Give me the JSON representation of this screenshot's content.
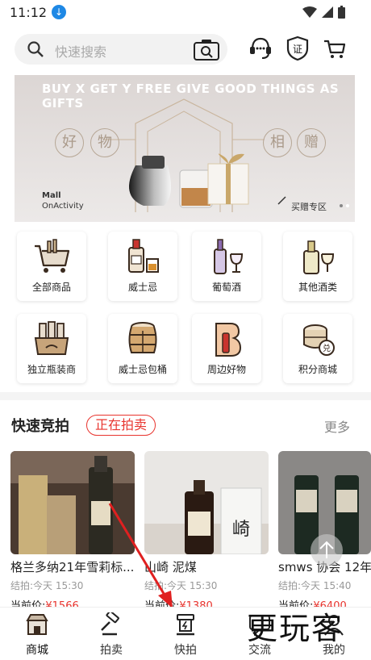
{
  "status_bar": {
    "time": "11:12"
  },
  "search": {
    "placeholder": "快速搜索"
  },
  "banner": {
    "headline": "BUY X GET Y FREE  GIVE GOOD THINGS AS GIFTS",
    "chars": [
      "好",
      "物",
      "相",
      "赠"
    ],
    "mall_line1": "Mall",
    "mall_line2": "OnActivity",
    "cta": "买赠专区"
  },
  "categories": [
    {
      "label": "全部商品",
      "icon": "shopping-cart-icon"
    },
    {
      "label": "威士忌",
      "icon": "whisky-bottle-icon"
    },
    {
      "label": "葡萄酒",
      "icon": "wine-bottle-icon"
    },
    {
      "label": "其他酒类",
      "icon": "other-bottle-icon"
    },
    {
      "label": "独立瓶装商",
      "icon": "bottle-crate-icon"
    },
    {
      "label": "威士忌包桶",
      "icon": "barrel-icon"
    },
    {
      "label": "周边好物",
      "icon": "merch-icon"
    },
    {
      "label": "积分商城",
      "icon": "points-coins-icon"
    }
  ],
  "auction": {
    "title": "快速竞拍",
    "tag": "正在拍卖",
    "more": "更多",
    "items": [
      {
        "title": "格兰多纳21年雪莉标...",
        "end": "结拍:今天 15:30",
        "price_prefix": "当前价:",
        "price": "¥1566"
      },
      {
        "title": "山崎 泥煤",
        "end": "结拍:今天 15:30",
        "price_prefix": "当前价:",
        "price": "¥1380"
      },
      {
        "title": "smws 协会 12年",
        "end": "结拍:今天 15:40",
        "price_prefix": "当前价:",
        "price": "¥6400"
      }
    ]
  },
  "tabbar": [
    {
      "label": "商城",
      "icon": "mall-icon"
    },
    {
      "label": "拍卖",
      "icon": "gavel-icon"
    },
    {
      "label": "快拍",
      "icon": "quick-auction-icon"
    },
    {
      "label": "交流",
      "icon": "chat-icon"
    },
    {
      "label": "我的",
      "icon": "profile-icon"
    }
  ],
  "watermark": "更玩客",
  "colors": {
    "accent": "#e8342e",
    "icon_brown": "#6b4a2b",
    "download_badge": "#1e88e5"
  }
}
